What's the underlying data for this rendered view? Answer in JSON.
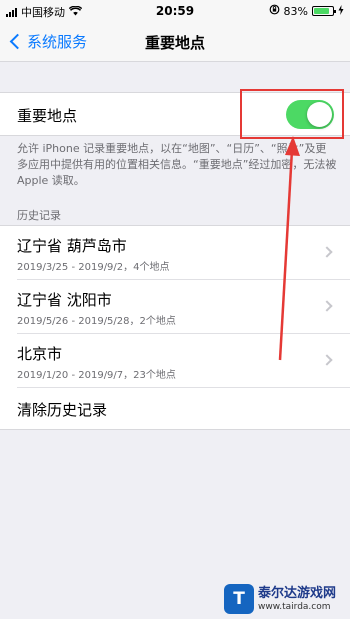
{
  "status": {
    "carrier": "中国移动",
    "time": "20:59",
    "battery_percent": "83%",
    "battery_level": 0.83
  },
  "nav": {
    "back_label": "系统服务",
    "title": "重要地点"
  },
  "setting": {
    "label": "重要地点",
    "enabled": true,
    "description": "允许 iPhone 记录重要地点，以在“地图”、“日历”、“照片”及更多应用中提供有用的位置相关信息。“重要地点”经过加密，无法被 Apple 读取。"
  },
  "history": {
    "header": "历史记录",
    "items": [
      {
        "title": "辽宁省 葫芦岛市",
        "detail": "2019/3/25 - 2019/9/2，4个地点"
      },
      {
        "title": "辽宁省 沈阳市",
        "detail": "2019/5/26 - 2019/5/28，2个地点"
      },
      {
        "title": "北京市",
        "detail": "2019/1/20 - 2019/9/7，23个地点"
      }
    ],
    "clear_label": "清除历史记录"
  },
  "watermark": {
    "name": "泰尔达游戏网",
    "url": "www.tairda.com",
    "logo_letter": "T"
  },
  "colors": {
    "accent": "#0a7aff",
    "switch_on": "#4cd964",
    "annotation": "#e53935",
    "background": "#efeff4"
  }
}
